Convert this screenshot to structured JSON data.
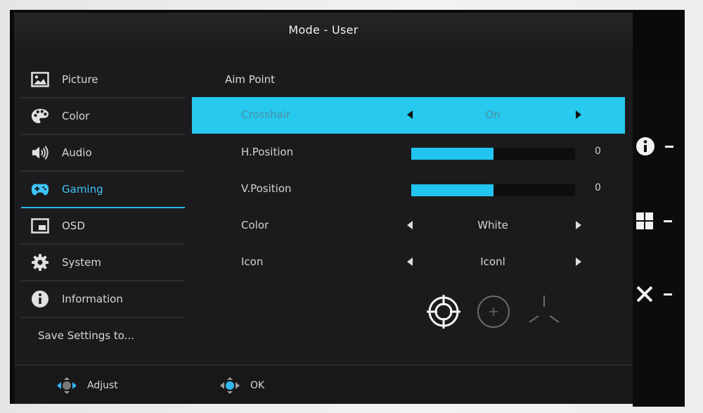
{
  "title": "Mode - User",
  "menu": {
    "items": [
      {
        "label": "Picture"
      },
      {
        "label": "Color"
      },
      {
        "label": "Audio"
      },
      {
        "label": "Gaming"
      },
      {
        "label": "OSD"
      },
      {
        "label": "System"
      },
      {
        "label": "Information"
      }
    ],
    "save_label": "Save Settings to..."
  },
  "section": {
    "title": "Aim Point"
  },
  "settings": {
    "crosshair": {
      "label": "Crosshair",
      "value": "On"
    },
    "h_position": {
      "label": "H.Position",
      "value": "0",
      "level": 0.5
    },
    "v_position": {
      "label": "V.Position",
      "value": "0",
      "level": 0.5
    },
    "color": {
      "label": "Color",
      "value": "White"
    },
    "icon": {
      "label": "Icon",
      "value": "Iconl"
    }
  },
  "crosshair_icons": [
    "crosshair-circle-icon",
    "crosshair-dot-icon",
    "crosshair-tri-icon"
  ],
  "footer": {
    "adjust_label": "Adjust",
    "ok_label": "OK"
  },
  "side_buttons": [
    "info-icon",
    "grid-icon",
    "close-icon"
  ],
  "colors": {
    "accent": "#27c9ee",
    "background": "#1b1b1d",
    "active_text": "#3ec4f8"
  }
}
